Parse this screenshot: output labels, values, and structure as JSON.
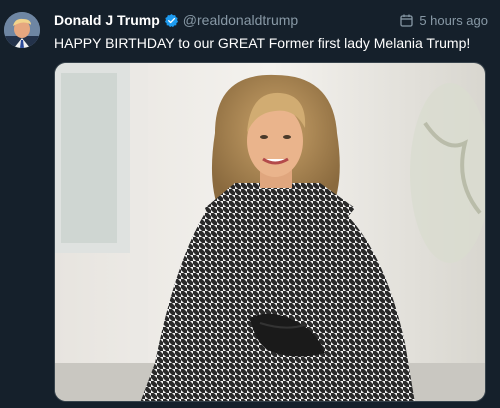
{
  "tweet": {
    "author_name": "Donald J Trump",
    "handle": "@realdonaldtrump",
    "timestamp": "5 hours ago",
    "text": "HAPPY BIRTHDAY to our GREAT Former first lady Melania Trump!",
    "verified": true
  },
  "icons": {
    "verified": "verified-badge-icon",
    "timestamp": "calendar-icon"
  },
  "colors": {
    "background": "#15202b",
    "secondary_text": "#8899a6",
    "verified_blue": "#1d9bf0"
  }
}
